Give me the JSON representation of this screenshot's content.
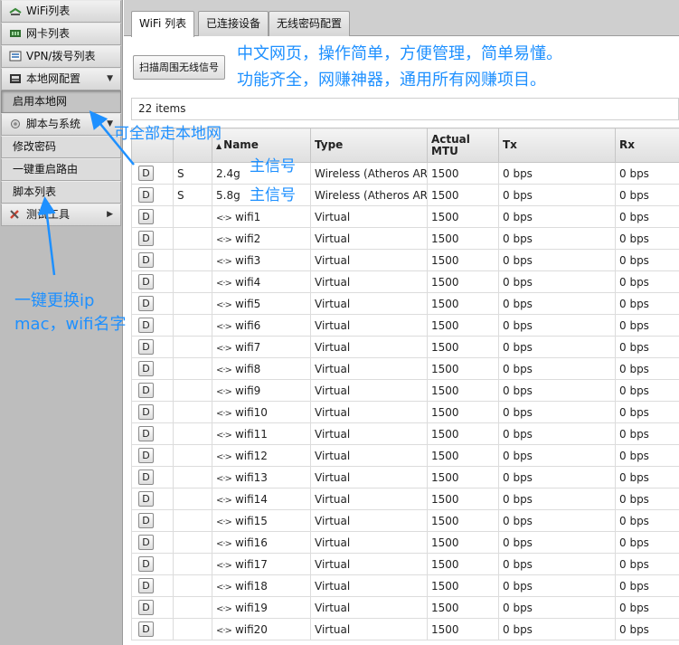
{
  "sidebar": {
    "items": [
      {
        "label": "WiFi列表",
        "icon": "wifi-icon"
      },
      {
        "label": "网卡列表",
        "icon": "network-card-icon"
      },
      {
        "label": "VPN/拨号列表",
        "icon": "vpn-icon"
      },
      {
        "label": "本地网配置",
        "icon": "lan-config-icon",
        "arrow": "▼"
      },
      {
        "label": "启用本地网",
        "sub": true,
        "active": true
      },
      {
        "label": "脚本与系统",
        "icon": "gear-icon",
        "arrow": "▼"
      },
      {
        "label": "修改密码",
        "sub": true
      },
      {
        "label": "一键重启路由",
        "sub": true
      },
      {
        "label": "脚本列表",
        "sub": true
      },
      {
        "label": "测试工具",
        "icon": "tools-icon",
        "arrow": "▶"
      }
    ]
  },
  "tabs": [
    {
      "label": "WiFi 列表",
      "active": true
    },
    {
      "label": "已连接设备",
      "active": false
    },
    {
      "label": "无线密码配置",
      "active": false
    }
  ],
  "toolbar": {
    "scan_label": "扫描周围无线信号"
  },
  "items_count": "22 items",
  "table": {
    "columns": [
      "",
      "",
      "Name",
      "Type",
      "Actual MTU",
      "Tx",
      "Rx"
    ],
    "sort_indicator": "▲",
    "rows": [
      {
        "btn": "D",
        "flag": "S",
        "name": "2.4g",
        "virtual": false,
        "type": "Wireless (Atheros AR",
        "mtu": "1500",
        "tx": "0 bps",
        "rx": "0 bps"
      },
      {
        "btn": "D",
        "flag": "S",
        "name": "5.8g",
        "virtual": false,
        "type": "Wireless (Atheros AR",
        "mtu": "1500",
        "tx": "0 bps",
        "rx": "0 bps"
      },
      {
        "btn": "D",
        "flag": "",
        "name": "wifi1",
        "virtual": true,
        "type": "Virtual",
        "mtu": "1500",
        "tx": "0 bps",
        "rx": "0 bps"
      },
      {
        "btn": "D",
        "flag": "",
        "name": "wifi2",
        "virtual": true,
        "type": "Virtual",
        "mtu": "1500",
        "tx": "0 bps",
        "rx": "0 bps"
      },
      {
        "btn": "D",
        "flag": "",
        "name": "wifi3",
        "virtual": true,
        "type": "Virtual",
        "mtu": "1500",
        "tx": "0 bps",
        "rx": "0 bps"
      },
      {
        "btn": "D",
        "flag": "",
        "name": "wifi4",
        "virtual": true,
        "type": "Virtual",
        "mtu": "1500",
        "tx": "0 bps",
        "rx": "0 bps"
      },
      {
        "btn": "D",
        "flag": "",
        "name": "wifi5",
        "virtual": true,
        "type": "Virtual",
        "mtu": "1500",
        "tx": "0 bps",
        "rx": "0 bps"
      },
      {
        "btn": "D",
        "flag": "",
        "name": "wifi6",
        "virtual": true,
        "type": "Virtual",
        "mtu": "1500",
        "tx": "0 bps",
        "rx": "0 bps"
      },
      {
        "btn": "D",
        "flag": "",
        "name": "wifi7",
        "virtual": true,
        "type": "Virtual",
        "mtu": "1500",
        "tx": "0 bps",
        "rx": "0 bps"
      },
      {
        "btn": "D",
        "flag": "",
        "name": "wifi8",
        "virtual": true,
        "type": "Virtual",
        "mtu": "1500",
        "tx": "0 bps",
        "rx": "0 bps"
      },
      {
        "btn": "D",
        "flag": "",
        "name": "wifi9",
        "virtual": true,
        "type": "Virtual",
        "mtu": "1500",
        "tx": "0 bps",
        "rx": "0 bps"
      },
      {
        "btn": "D",
        "flag": "",
        "name": "wifi10",
        "virtual": true,
        "type": "Virtual",
        "mtu": "1500",
        "tx": "0 bps",
        "rx": "0 bps"
      },
      {
        "btn": "D",
        "flag": "",
        "name": "wifi11",
        "virtual": true,
        "type": "Virtual",
        "mtu": "1500",
        "tx": "0 bps",
        "rx": "0 bps"
      },
      {
        "btn": "D",
        "flag": "",
        "name": "wifi12",
        "virtual": true,
        "type": "Virtual",
        "mtu": "1500",
        "tx": "0 bps",
        "rx": "0 bps"
      },
      {
        "btn": "D",
        "flag": "",
        "name": "wifi13",
        "virtual": true,
        "type": "Virtual",
        "mtu": "1500",
        "tx": "0 bps",
        "rx": "0 bps"
      },
      {
        "btn": "D",
        "flag": "",
        "name": "wifi14",
        "virtual": true,
        "type": "Virtual",
        "mtu": "1500",
        "tx": "0 bps",
        "rx": "0 bps"
      },
      {
        "btn": "D",
        "flag": "",
        "name": "wifi15",
        "virtual": true,
        "type": "Virtual",
        "mtu": "1500",
        "tx": "0 bps",
        "rx": "0 bps"
      },
      {
        "btn": "D",
        "flag": "",
        "name": "wifi16",
        "virtual": true,
        "type": "Virtual",
        "mtu": "1500",
        "tx": "0 bps",
        "rx": "0 bps"
      },
      {
        "btn": "D",
        "flag": "",
        "name": "wifi17",
        "virtual": true,
        "type": "Virtual",
        "mtu": "1500",
        "tx": "0 bps",
        "rx": "0 bps"
      },
      {
        "btn": "D",
        "flag": "",
        "name": "wifi18",
        "virtual": true,
        "type": "Virtual",
        "mtu": "1500",
        "tx": "0 bps",
        "rx": "0 bps"
      },
      {
        "btn": "D",
        "flag": "",
        "name": "wifi19",
        "virtual": true,
        "type": "Virtual",
        "mtu": "1500",
        "tx": "0 bps",
        "rx": "0 bps"
      },
      {
        "btn": "D",
        "flag": "",
        "name": "wifi20",
        "virtual": true,
        "type": "Virtual",
        "mtu": "1500",
        "tx": "0 bps",
        "rx": "0 bps"
      }
    ]
  },
  "annotations": {
    "promo_line1": "中文网页，操作简单，方便管理，简单易懂。",
    "promo_line2": "功能齐全，网赚神器，通用所有网赚项目。",
    "local_net": "可全部走本地网",
    "main_signal_1": "主信号",
    "main_signal_2": "主信号",
    "change_line1": "一键更换ip",
    "change_line2": "mac，wifi名字"
  },
  "colors": {
    "annotation": "#1e90ff"
  }
}
